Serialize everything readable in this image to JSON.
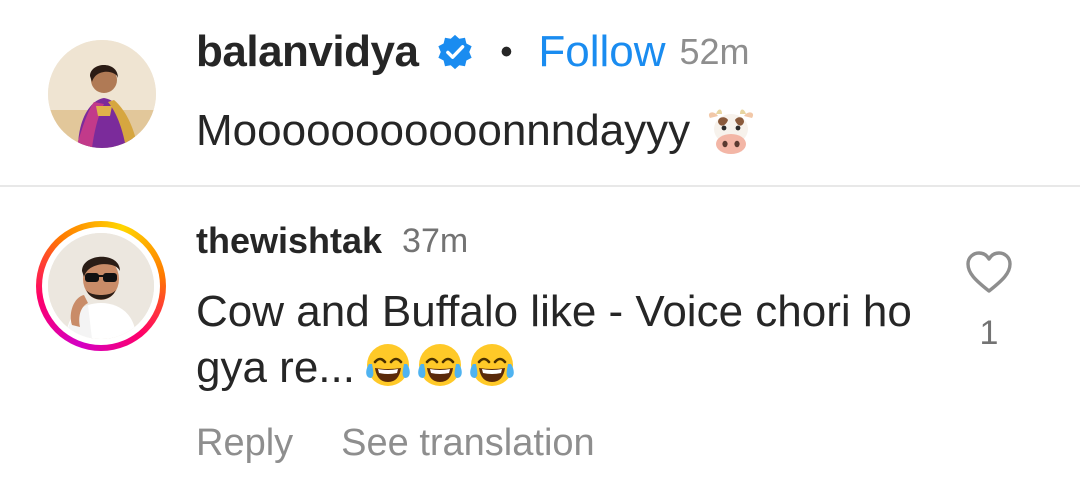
{
  "caption": {
    "avatar_icon": "profile-photo-woman-purple-saree",
    "username": "balanvidya",
    "verified_icon": "verified-badge-icon",
    "separator": "•",
    "follow_label": "Follow",
    "time": "52m",
    "text": "Mooooooooooonnndayyy",
    "emoji": "cow-face-emoji"
  },
  "comment": {
    "avatar_icon": "profile-photo-man-sunglasses",
    "username": "thewishtak",
    "time": "37m",
    "text": "Cow and Buffalo like -  Voice chori ho gya re...",
    "emojis": [
      "tears-of-joy-emoji",
      "tears-of-joy-emoji",
      "tears-of-joy-emoji"
    ],
    "actions": {
      "reply": "Reply",
      "see_translation": "See translation"
    },
    "like_icon": "heart-outline-icon",
    "like_count": "1"
  },
  "colors": {
    "follow_blue": "#1a8cf0",
    "verified_blue": "#1a8cf0",
    "text_primary": "#262626",
    "text_secondary": "#8e8e8e",
    "divider": "#e8e8e8"
  }
}
